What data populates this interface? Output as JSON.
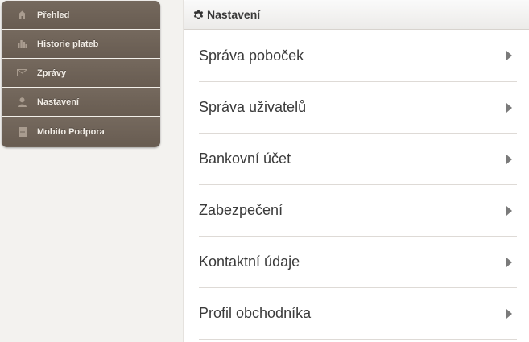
{
  "sidebar": {
    "items": [
      {
        "label": "Přehled",
        "icon": "home-icon"
      },
      {
        "label": "Historie plateb",
        "icon": "bar-chart-icon"
      },
      {
        "label": "Zprávy",
        "icon": "envelope-icon"
      },
      {
        "label": "Nastavení",
        "icon": "user-icon"
      },
      {
        "label": "Mobito Podpora",
        "icon": "document-icon"
      }
    ]
  },
  "panel": {
    "title": "Nastavení",
    "title_icon": "gear-icon",
    "items": [
      {
        "label": "Správa poboček"
      },
      {
        "label": "Správa uživatelů"
      },
      {
        "label": "Bankovní účet"
      },
      {
        "label": "Zabezpečení"
      },
      {
        "label": "Kontaktní údaje"
      },
      {
        "label": "Profil obchodníka"
      }
    ]
  },
  "colors": {
    "sidebar_bg": "#6f6358",
    "sidebar_text": "#f2ede6",
    "page_bg": "#f3f2ef",
    "panel_bg": "#ffffff",
    "text": "#3b3b3b"
  }
}
